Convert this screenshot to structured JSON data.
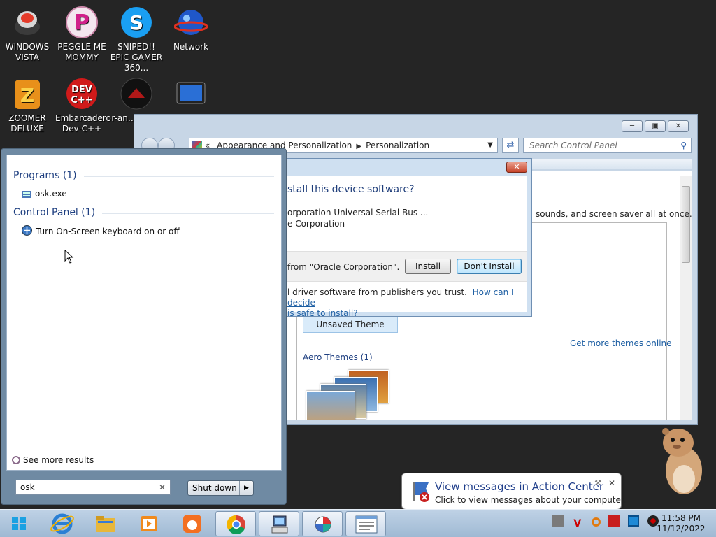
{
  "desktop": {
    "icons": [
      {
        "label": "WINDOWS VISTA"
      },
      {
        "label": "PEGGLE ME MOMMY"
      },
      {
        "label": "SNIPED!! EPIC GAMER 360..."
      },
      {
        "label": "Network"
      },
      {
        "label": "ZOOMER DELUXE"
      },
      {
        "label": "Embarcadero Dev-C++"
      },
      {
        "label": "r-an… par…"
      },
      {
        "label": ""
      }
    ]
  },
  "control_panel": {
    "breadcrumb": {
      "chevrons": "«",
      "part1": "Appearance and Personalization",
      "part2": "Personalization"
    },
    "search_placeholder": "Search Control Panel",
    "description": "sounds, and screen saver all at once.",
    "unsaved_theme": "Unsaved Theme",
    "get_more_link": "Get more themes online",
    "aero_header": "Aero Themes (1)"
  },
  "dialog": {
    "question": "stall this device software?",
    "line1": "orporation Universal Serial Bus ...",
    "line2": "e Corporation",
    "publisher": "from \"Oracle Corporation\".",
    "install_label": "Install",
    "dont_install_label": "Don't Install",
    "footer_text": "l driver software from publishers you trust.",
    "footer_link_1": "How can I decide",
    "footer_link_2": "is safe to install?"
  },
  "start_menu": {
    "programs_header": "Programs (1)",
    "program_item": "osk.exe",
    "control_panel_header": "Control Panel (1)",
    "cp_item": "Turn On-Screen keyboard on or off",
    "see_more": "See more results",
    "search_value": "osk",
    "shutdown_label": "Shut down"
  },
  "balloon": {
    "title": "View messages in Action Center",
    "subtitle": "Click to view messages about your computer."
  },
  "taskbar": {
    "time": "11:58 PM",
    "date": "11/12/2022"
  }
}
